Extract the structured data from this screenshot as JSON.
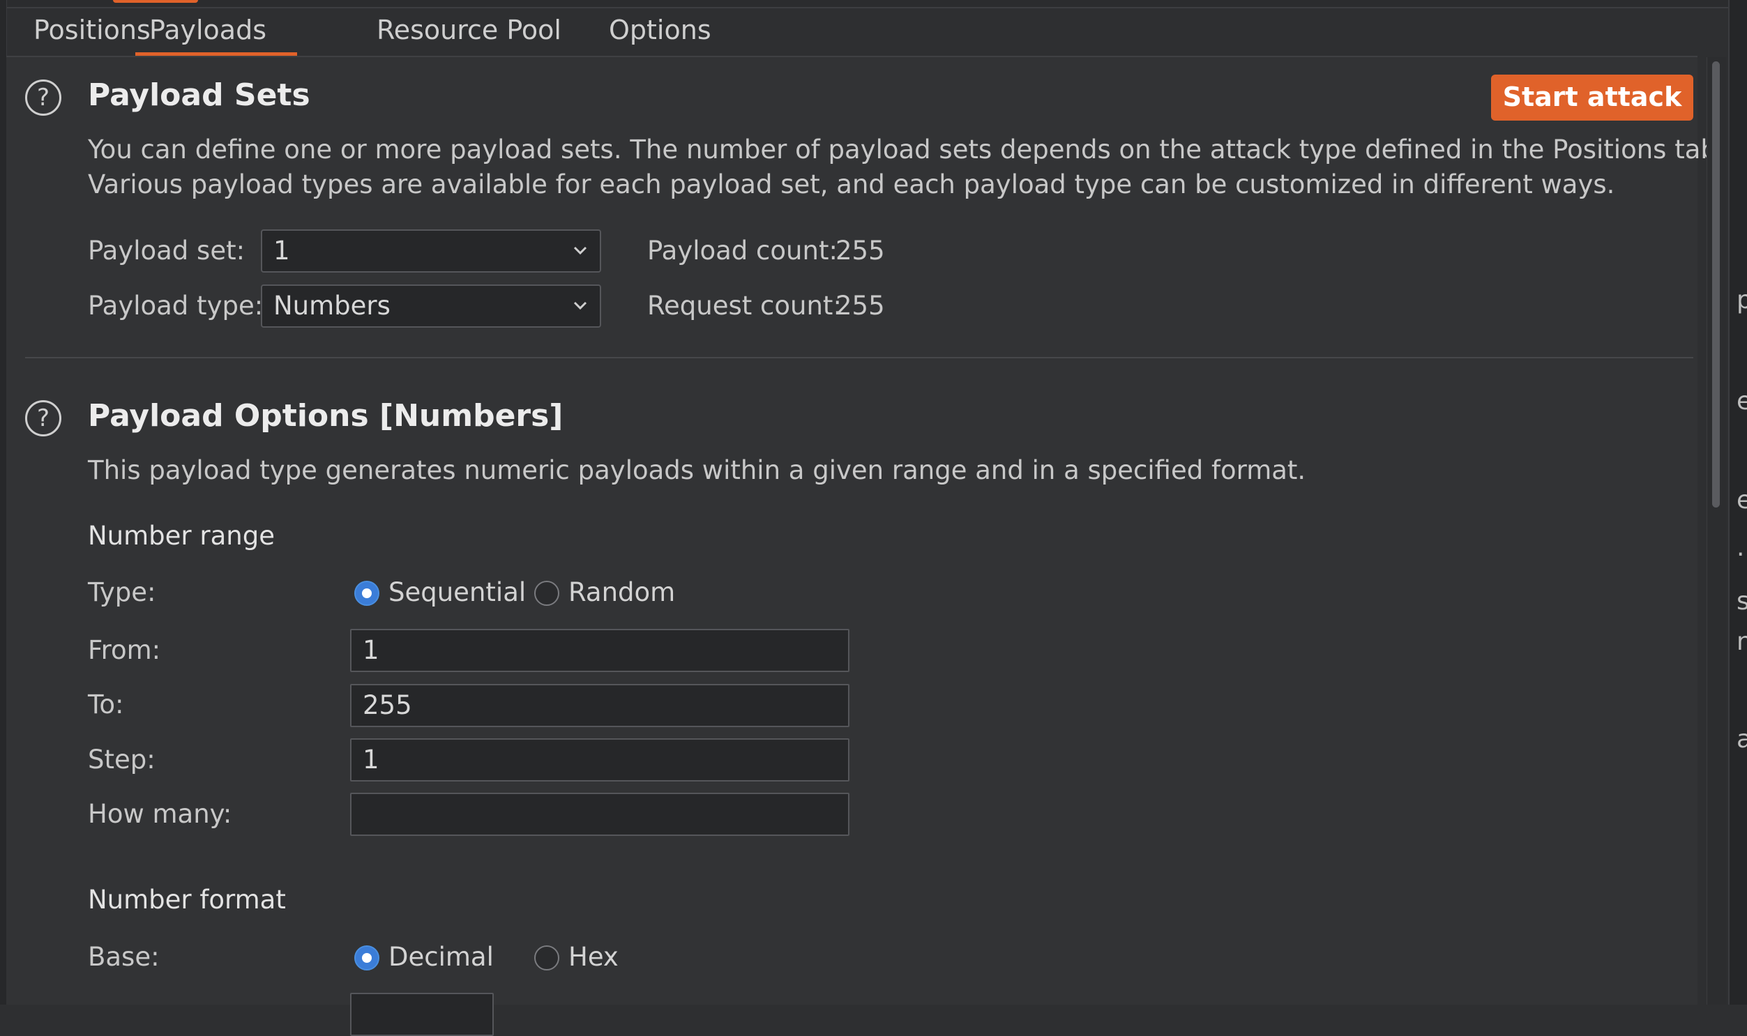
{
  "tabs": [
    {
      "label": "Positions",
      "active": false
    },
    {
      "label": "Payloads",
      "active": true
    },
    {
      "label": "Resource Pool",
      "active": false
    },
    {
      "label": "Options",
      "active": false
    }
  ],
  "payload_sets": {
    "help_icon": "?",
    "title": "Payload Sets",
    "start_attack_label": "Start attack",
    "description_line1": "You can define one or more payload sets. The number of payload sets depends on the attack type defined in the Positions tab.",
    "description_line2": "Various payload types are available for each payload set, and each payload type can be customized in different ways.",
    "payload_set_label": "Payload set:",
    "payload_set_value": "1",
    "payload_type_label": "Payload type:",
    "payload_type_value": "Numbers",
    "payload_count_label": "Payload count:",
    "payload_count_value": "255",
    "request_count_label": "Request count:",
    "request_count_value": "255"
  },
  "payload_options": {
    "help_icon": "?",
    "title": "Payload Options [Numbers]",
    "description": "This payload type generates numeric payloads within a given range and in a specified format.",
    "number_range": {
      "heading": "Number range",
      "type_label": "Type:",
      "type_options": [
        "Sequential",
        "Random"
      ],
      "type_selected": "Sequential",
      "from_label": "From:",
      "from_value": "1",
      "to_label": "To:",
      "to_value": "255",
      "step_label": "Step:",
      "step_value": "1",
      "how_many_label": "How many:",
      "how_many_value": ""
    },
    "number_format": {
      "heading": "Number format",
      "base_label": "Base:",
      "base_options": [
        "Decimal",
        "Hex"
      ],
      "base_selected": "Decimal"
    }
  },
  "icons": {
    "help": "question-circle-icon",
    "dropdown": "chevron-down-icon"
  },
  "colors": {
    "accent": "#e0622a",
    "radio_checked": "#3b7dd8",
    "background": "#323335"
  },
  "right_edge_fragments": [
    "p",
    "e",
    "er",
    ".",
    "s",
    "n",
    "a"
  ]
}
